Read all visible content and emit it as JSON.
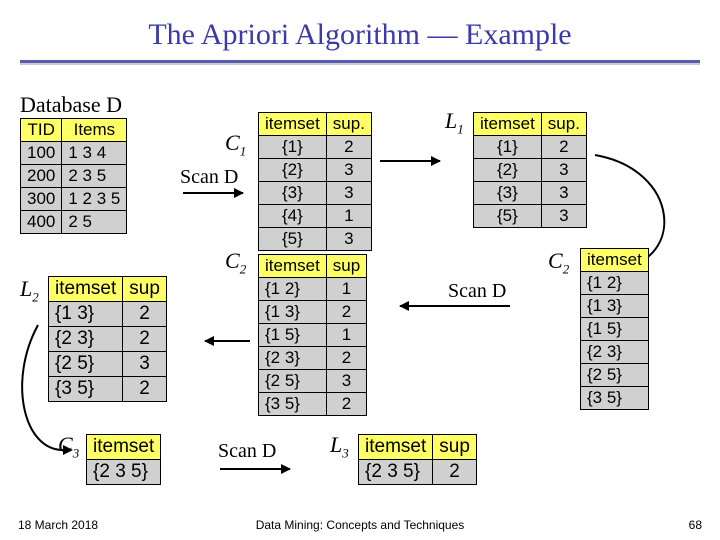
{
  "title": "The Apriori Algorithm — Example",
  "labels": {
    "databaseD": "Database D",
    "c1": "C",
    "c1sub": "1",
    "l1": "L",
    "l1sub": "1",
    "c2a": "C",
    "c2asub": "2",
    "c2b": "C",
    "c2bsub": "2",
    "l2": "L",
    "l2sub": "2",
    "c3": "C",
    "c3sub": "3",
    "l3": "L",
    "l3sub": "3",
    "scan1": "Scan D",
    "scan2": "Scan D",
    "scan3": "Scan D"
  },
  "headers": {
    "tid": "TID",
    "items": "Items",
    "itemset": "itemset",
    "sup": "sup",
    "supDot": "sup."
  },
  "tables": {
    "D": [
      [
        "100",
        "1 3 4"
      ],
      [
        "200",
        "2 3 5"
      ],
      [
        "300",
        "1 2 3 5"
      ],
      [
        "400",
        "2 5"
      ]
    ],
    "C1": [
      [
        "{1}",
        "2"
      ],
      [
        "{2}",
        "3"
      ],
      [
        "{3}",
        "3"
      ],
      [
        "{4}",
        "1"
      ],
      [
        "{5}",
        "3"
      ]
    ],
    "L1": [
      [
        "{1}",
        "2"
      ],
      [
        "{2}",
        "3"
      ],
      [
        "{3}",
        "3"
      ],
      [
        "{5}",
        "3"
      ]
    ],
    "C2items": [
      "{1 2}",
      "{1 3}",
      "{1 5}",
      "{2 3}",
      "{2 5}",
      "{3 5}"
    ],
    "C2sup": [
      [
        "{1 2}",
        "1"
      ],
      [
        "{1 3}",
        "2"
      ],
      [
        "{1 5}",
        "1"
      ],
      [
        "{2 3}",
        "2"
      ],
      [
        "{2 5}",
        "3"
      ],
      [
        "{3 5}",
        "2"
      ]
    ],
    "L2": [
      [
        "{1 3}",
        "2"
      ],
      [
        "{2 3}",
        "2"
      ],
      [
        "{2 5}",
        "3"
      ],
      [
        "{3 5}",
        "2"
      ]
    ],
    "C3": [
      "{2 3 5}"
    ],
    "L3": [
      [
        "{2 3 5}",
        "2"
      ]
    ]
  },
  "footer": {
    "date": "18 March 2018",
    "center": "Data Mining: Concepts and Techniques",
    "page": "68"
  }
}
